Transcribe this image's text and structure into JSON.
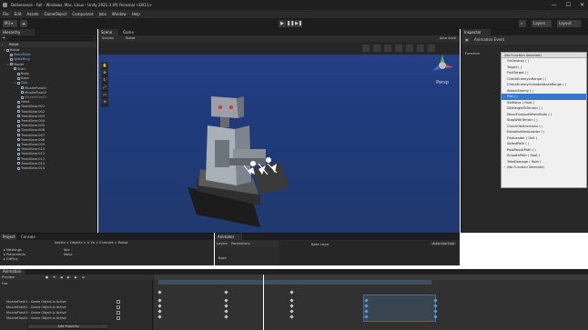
{
  "window": {
    "title": "Deliverance - Fall - Windows, Mac, Linux - Unity 2021.3.4f1 Personal <DX11>",
    "controls": [
      "—",
      "☐",
      "✕"
    ]
  },
  "menu": [
    "File",
    "Edit",
    "Assets",
    "GameObject",
    "Component",
    "Jobs",
    "Window",
    "Help"
  ],
  "toolbar": {
    "account": "M3 ▾",
    "layers": "Layers",
    "layout": "Layout",
    "play": "▶",
    "pause": "❚❚",
    "step": "▶❚"
  },
  "hierarchy": {
    "tab": "Hierarchy",
    "breadcrumb": "Robot",
    "items": [
      {
        "label": "Robot",
        "indent": 0,
        "style": "normal",
        "open": true
      },
      {
        "label": "MovePoint",
        "indent": 1,
        "style": "blue"
      },
      {
        "label": "SpikeRing",
        "indent": 1,
        "style": "blue"
      },
      {
        "label": "Model",
        "indent": 1,
        "style": "normal",
        "open": true
      },
      {
        "label": "Scan",
        "indent": 2,
        "style": "normal"
      },
      {
        "label": "Body",
        "indent": 3,
        "style": "normal"
      },
      {
        "label": "Base",
        "indent": 3,
        "style": "normal"
      },
      {
        "label": "Gun",
        "indent": 3,
        "style": "normal",
        "open": true
      },
      {
        "label": "MuzzleFlash1",
        "indent": 4,
        "style": "normal"
      },
      {
        "label": "MuzzleFlash2",
        "indent": 4,
        "style": "normal"
      },
      {
        "label": "MuzzleFlash3",
        "indent": 4,
        "style": "dim"
      },
      {
        "label": "Head",
        "indent": 3,
        "style": "normal"
      },
      {
        "label": "TreadGear.001",
        "indent": 3,
        "style": "normal"
      },
      {
        "label": "TreadGear.002",
        "indent": 3,
        "style": "normal"
      },
      {
        "label": "TreadGear.003",
        "indent": 3,
        "style": "normal"
      },
      {
        "label": "TreadGear.004",
        "indent": 3,
        "style": "normal"
      },
      {
        "label": "TreadGear.005",
        "indent": 3,
        "style": "normal"
      },
      {
        "label": "TreadGear.006",
        "indent": 3,
        "style": "normal"
      },
      {
        "label": "TreadGear.007",
        "indent": 3,
        "style": "normal"
      },
      {
        "label": "TreadGear.008",
        "indent": 3,
        "style": "normal"
      },
      {
        "label": "TreadGear.009",
        "indent": 3,
        "style": "normal"
      },
      {
        "label": "TreadGear.010",
        "indent": 3,
        "style": "normal"
      },
      {
        "label": "TreadGear.011",
        "indent": 3,
        "style": "normal"
      },
      {
        "label": "TreadGear.012",
        "indent": 3,
        "style": "normal"
      },
      {
        "label": "TreadGear.013",
        "indent": 3,
        "style": "normal"
      },
      {
        "label": "TreadGear.014",
        "indent": 3,
        "style": "normal"
      }
    ]
  },
  "scene": {
    "tabs": [
      "Scene",
      "Game"
    ],
    "breadcrumb": "Robot",
    "scenes_label": "Scenes",
    "autosave": "Auto Save",
    "gizmo_label": "Persp"
  },
  "inspector": {
    "tab": "Inspector",
    "header": "Animation Event",
    "function_label": "Function",
    "function_value": "(No Function Selected)",
    "options": [
      "OnDestroy ( )",
      "Target ( )",
      "FindTarget ( )",
      "CheckEnemyInRange ( )",
      "CheckEnemyOutsideAttackRange ( )",
      "AttackEnemy ( )",
      "Fire ( )",
      "SetMove ( float )",
      "SetHeightToTerrain ( )",
      "MoveForwardWhenMode ( )",
      "StopWithTerrain ( )",
      "CheckObstructions ( )",
      "EstablishNewLeader ( )",
      "FindLeader ( Unit )",
      "SafestPath ( )",
      "PostResultPath ( )",
      "SmoothPath ( float )",
      "TakeDamage ( float )",
      "(No Function Selected)"
    ],
    "highlighted_index": 6,
    "checked_index": 18
  },
  "project": {
    "tabs": [
      "Project",
      "Console"
    ],
    "breadcrumb": "Assets > Objects > U Vo > Enemies > Robot",
    "folders": [
      "Meshings",
      "Placements",
      "GitPlus"
    ],
    "files": [
      "Idle",
      "Move"
    ]
  },
  "animator": {
    "tab": "Animator",
    "subtabs": [
      "Layers",
      "Parameters"
    ],
    "layer": "Base Layer",
    "base": "Base",
    "auto_live": "Auto Live Link"
  },
  "animation": {
    "tab": "Animation",
    "preview": "Preview",
    "clip": "Fire",
    "properties": [
      "MuzzleFlash1 : Game Object.Is Active",
      "MuzzleFlash2 : Game Object.Is Active",
      "MuzzleFlash3 : Game Object.Is Active",
      "MuzzleFlash4 : Game Object.Is Active"
    ],
    "add_property": "Add Property"
  },
  "colors": {
    "accent": "#3478d0",
    "scene_sky": "#22408a"
  }
}
